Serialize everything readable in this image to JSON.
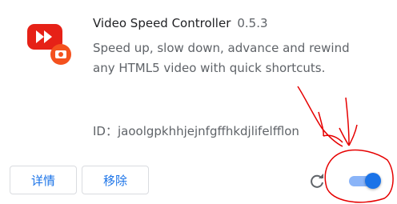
{
  "extension": {
    "name": "Video Speed Controller",
    "version": "0.5.3",
    "description": "Speed up, slow down, advance and rewind any HTML5 video with quick shortcuts.",
    "id_label": "ID：",
    "id_value": "jaoolgpkhhjejnfgffhkdjlifelfflon",
    "icon": "video-speed-controller-icon"
  },
  "footer": {
    "details_label": "详情",
    "remove_label": "移除",
    "reload_icon": "reload-icon",
    "enabled": true
  },
  "colors": {
    "accent": "#1a73e8",
    "toggle_track": "#8ab4f8",
    "icon_red": "#e62117",
    "icon_orange": "#f4511e",
    "annotation_red": "#e60000"
  }
}
